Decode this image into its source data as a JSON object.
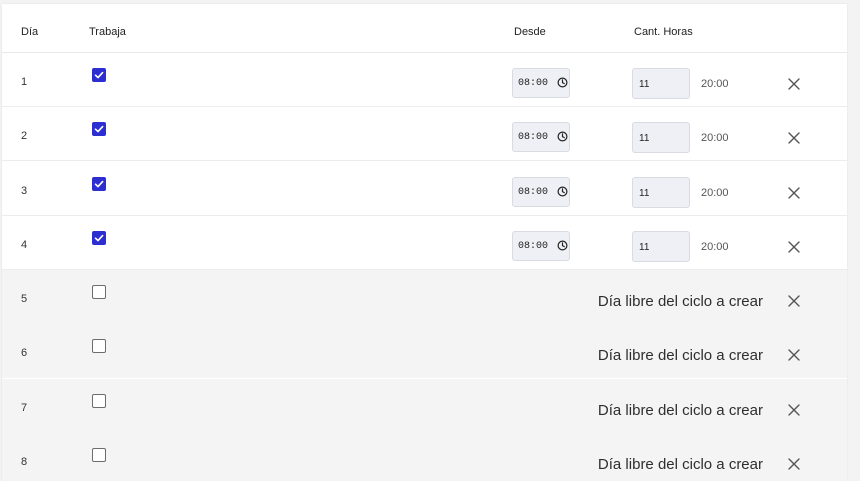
{
  "table": {
    "headers": {
      "day": "Día",
      "works": "Trabaja",
      "from": "Desde",
      "hours": "Cant. Horas"
    },
    "rows": [
      {
        "day": "1",
        "works": true,
        "from": "08:00",
        "hours": "11",
        "until": "20:00"
      },
      {
        "day": "2",
        "works": true,
        "from": "08:00",
        "hours": "11",
        "until": "20:00"
      },
      {
        "day": "3",
        "works": true,
        "from": "08:00",
        "hours": "11",
        "until": "20:00"
      },
      {
        "day": "4",
        "works": true,
        "from": "08:00",
        "hours": "11",
        "until": "20:00"
      },
      {
        "day": "5",
        "works": false,
        "free_text": "Día libre del ciclo a crear"
      },
      {
        "day": "6",
        "works": false,
        "free_text": "Día libre del ciclo a crear"
      },
      {
        "day": "7",
        "works": false,
        "free_text": "Día libre del ciclo a crear"
      },
      {
        "day": "8",
        "works": false,
        "free_text": "Día libre del ciclo a crear"
      }
    ]
  },
  "icons": {
    "checkbox_checked": "check-icon",
    "time_picker": "clock-icon",
    "remove_row": "close-icon"
  },
  "colors": {
    "accent": "#2c2ed1",
    "free_row_bg": "#f4f4f4",
    "input_bg": "#eef0f5"
  }
}
